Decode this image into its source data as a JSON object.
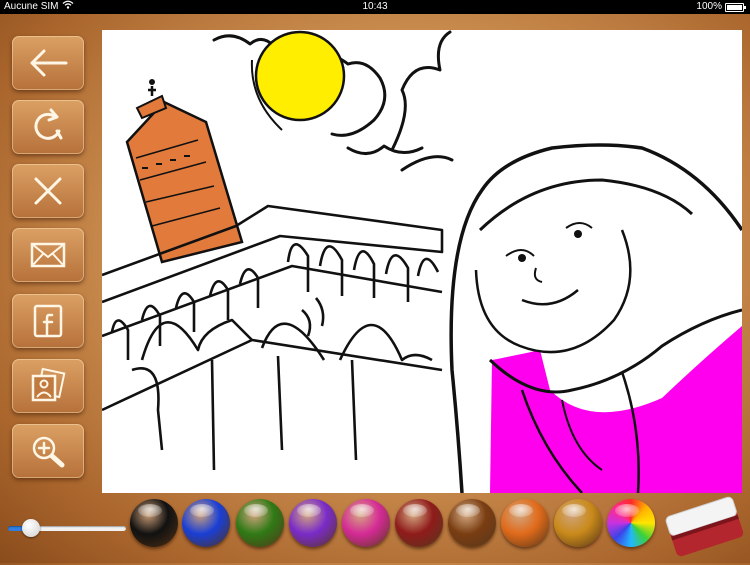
{
  "status_bar": {
    "carrier": "Aucune SIM",
    "time": "10:43",
    "battery": "100%"
  },
  "toolbar": {
    "buttons": [
      {
        "name": "back-button",
        "icon": "arrow-left-icon"
      },
      {
        "name": "redo-button",
        "icon": "rotate-icon"
      },
      {
        "name": "clear-button",
        "icon": "close-icon"
      },
      {
        "name": "email-button",
        "icon": "envelope-icon"
      },
      {
        "name": "facebook-button",
        "icon": "facebook-icon"
      },
      {
        "name": "photos-button",
        "icon": "photo-icon"
      },
      {
        "name": "zoom-button",
        "icon": "zoom-in-icon"
      }
    ]
  },
  "brush_size": 0.18,
  "palette": [
    {
      "name": "black",
      "color": "#111111"
    },
    {
      "name": "blue",
      "color": "#1a3fd6"
    },
    {
      "name": "green",
      "color": "#2f7a16"
    },
    {
      "name": "purple",
      "color": "#7a2bc9"
    },
    {
      "name": "pink",
      "color": "#d52a96"
    },
    {
      "name": "dark-red",
      "color": "#8f1b1b"
    },
    {
      "name": "brown",
      "color": "#7a3d12"
    },
    {
      "name": "orange",
      "color": "#e06a1a"
    },
    {
      "name": "gold",
      "color": "#c98a1a"
    },
    {
      "name": "rainbow",
      "color": "multicolor"
    }
  ],
  "colors": {
    "sun": "#ffee00",
    "minaret": "#e27a3c",
    "clothing": "#ff00ee",
    "canvas": "#ffffff"
  }
}
